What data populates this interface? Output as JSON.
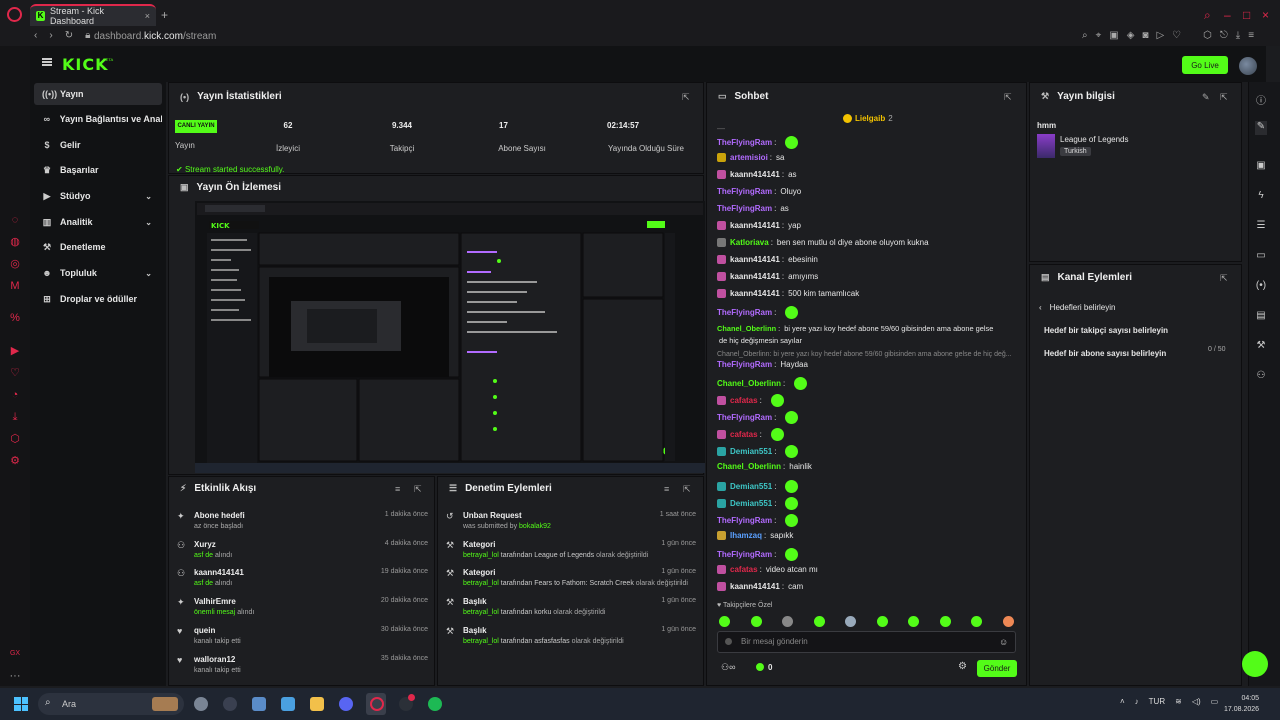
{
  "browser": {
    "tab_title": "Stream - Kick Dashboard",
    "url_prefix": "dashboard.",
    "url_domain": "kick.com",
    "url_path": "/stream"
  },
  "kick": {
    "logo": "KICK",
    "beta": "BETA",
    "go_live": "Go Live"
  },
  "sidebar": {
    "items": [
      {
        "label": "Yayın",
        "icon": "broadcast-icon"
      },
      {
        "label": "Yayın Bağlantısı ve Anahtarı",
        "icon": "link-icon"
      },
      {
        "label": "Gelir",
        "icon": "dollar-icon"
      },
      {
        "label": "Başarılar",
        "icon": "trophy-icon"
      },
      {
        "label": "Stüdyo",
        "icon": "video-icon"
      },
      {
        "label": "Analitik",
        "icon": "chart-icon"
      },
      {
        "label": "Denetleme",
        "icon": "gavel-icon"
      },
      {
        "label": "Topluluk",
        "icon": "people-icon"
      },
      {
        "label": "Droplar ve ödüller",
        "icon": "gift-icon"
      }
    ]
  },
  "stats": {
    "title": "Yayın İstatistikleri",
    "live_badge": "CANLI YAYIN",
    "stream_label": "Yayın",
    "items": [
      {
        "value": "62",
        "label": "İzleyici"
      },
      {
        "value": "9.344",
        "label": "Takipçi"
      },
      {
        "value": "17",
        "label": "Abone Sayısı"
      },
      {
        "value": "02:14:57",
        "label": "Yayında Olduğu Süre"
      }
    ],
    "status": "Stream started successfully."
  },
  "preview": {
    "title": "Yayın Ön İzlemesi"
  },
  "activity": {
    "title": "Etkinlik Akışı",
    "items": [
      {
        "title": "Abone hedefi",
        "sub": "az önce başladı",
        "hl": "",
        "time": "1 dakika önce"
      },
      {
        "title": "Xuryz",
        "sub": " alındı",
        "hl": "asf de",
        "time": "4 dakika önce"
      },
      {
        "title": "kaann414141",
        "sub": " alındı",
        "hl": "asf de",
        "time": "19 dakika önce"
      },
      {
        "title": "VaIhirEmre",
        "sub": " alındı",
        "hl": "önemli mesaj",
        "time": "20 dakika önce"
      },
      {
        "title": "quein",
        "sub": "kanalı takip etti",
        "hl": "",
        "time": "30 dakika önce"
      },
      {
        "title": "walloran12",
        "sub": "kanalı takip etti",
        "hl": "",
        "time": "35 dakika önce"
      }
    ]
  },
  "moderation": {
    "title": "Denetim Eylemleri",
    "items": [
      {
        "title": "Unban Request",
        "pre": "was submitted by ",
        "hl": "bokalak92",
        "post": "",
        "time": "1 saat önce"
      },
      {
        "title": "Kategori",
        "pre": "betrayal_lol",
        "hl": " tarafından League of Legends",
        "post": " olarak değiştirildi",
        "time": "1 gün önce"
      },
      {
        "title": "Kategori",
        "pre": "betrayal_lol",
        "hl": " tarafından Fears to Fathom: Scratch Creek",
        "post": " olarak değiştirildi",
        "time": "1 gün önce"
      },
      {
        "title": "Başlık",
        "pre": "betrayal_lol",
        "hl": " tarafından korku",
        "post": " olarak değiştirildi",
        "time": "1 gün önce"
      },
      {
        "title": "Başlık",
        "pre": "betrayal_lol",
        "hl": " tarafından asfasfasfas",
        "post": " olarak değiştirildi",
        "time": "1 gün önce"
      }
    ]
  },
  "chat": {
    "title": "Sohbet",
    "pinned_user": "Lielgaib",
    "pinned_count": "2",
    "messages": [
      {
        "user": "TheFlyingRam",
        "color": "#b26bff",
        "text": "",
        "emote": true
      },
      {
        "user": "artemisioi",
        "color": "#b26bff",
        "text": "sa",
        "emote": false
      },
      {
        "user": "kaann414141",
        "color": "#e6e6e6",
        "text": "as",
        "emote": false
      },
      {
        "user": "TheFlyingRam",
        "color": "#b26bff",
        "text": "Oluyo",
        "emote": false
      },
      {
        "user": "TheFlyingRam",
        "color": "#b26bff",
        "text": "as",
        "emote": false
      },
      {
        "user": "kaann414141",
        "color": "#e6e6e6",
        "text": "yap",
        "emote": false
      },
      {
        "user": "Katloriava",
        "color": "#53fc18",
        "text": "ben sen mutlu ol diye abone oluyom kukna",
        "emote": false
      },
      {
        "user": "kaann414141",
        "color": "#e6e6e6",
        "text": "ebesinin",
        "emote": false
      },
      {
        "user": "kaann414141",
        "color": "#e6e6e6",
        "text": "amıyıms",
        "emote": false
      },
      {
        "user": "kaann414141",
        "color": "#e6e6e6",
        "text": "500 kim tamamlıcak",
        "emote": false
      },
      {
        "user": "TheFlyingRam",
        "color": "#b26bff",
        "text": "",
        "emote": true
      },
      {
        "user": "Chanel_Oberlinn",
        "color": "#53fc18",
        "text": "bi yere yazı koy hedef abone 59/60 gibisinden ama abone gelse",
        "emote": false
      },
      {
        "user": "",
        "color": "#e6e6e6",
        "text": "de hiç değişmesin sayılar",
        "emote": false
      },
      {
        "user": "TheFlyingRam",
        "color": "#b26bff",
        "text": "Haydaa",
        "emote": false
      },
      {
        "user": "Chanel_Oberlinn",
        "color": "#53fc18",
        "text": "",
        "emote": true
      },
      {
        "user": "cafatas",
        "color": "#e0284b",
        "text": "",
        "emote": true
      },
      {
        "user": "TheFlyingRam",
        "color": "#b26bff",
        "text": "",
        "emote": true
      },
      {
        "user": "cafatas",
        "color": "#e0284b",
        "text": "",
        "emote": true
      },
      {
        "user": "Demian551",
        "color": "#3ec7c7",
        "text": "",
        "emote": true
      },
      {
        "user": "Chanel_Oberlinn",
        "color": "#53fc18",
        "text": "hainlik",
        "emote": false
      },
      {
        "user": "Demian551",
        "color": "#3ec7c7",
        "text": "",
        "emote": true
      },
      {
        "user": "Demian551",
        "color": "#3ec7c7",
        "text": "",
        "emote": true
      },
      {
        "user": "TheFlyingRam",
        "color": "#b26bff",
        "text": "",
        "emote": true
      },
      {
        "user": "Ihamzaq",
        "color": "#5aa0ff",
        "text": "sapıkk",
        "emote": false
      },
      {
        "user": "TheFlyingRam",
        "color": "#b26bff",
        "text": "",
        "emote": true
      },
      {
        "user": "cafatas",
        "color": "#e0284b",
        "text": "video atcan mı",
        "emote": false
      },
      {
        "user": "kaann414141",
        "color": "#e6e6e6",
        "text": "cam",
        "emote": false
      }
    ],
    "reply_text": "Chanel_Oberlinn: bi yere yazı koy hedef abone 59/60 gibisinden ama abone gelse de hiç değ...",
    "emote_label": "Takipçilere Özel",
    "input_placeholder": "Bir mesaj gönderin",
    "count": "0",
    "send_label": "Gönder"
  },
  "info": {
    "title": "Yayın bilgisi",
    "stream_title": "hmm",
    "category": "League of Legends",
    "language": "Turkish"
  },
  "channel_actions": {
    "title": "Kanal Eylemleri",
    "back_label": "Hedefleri belirleyin",
    "items": [
      {
        "label": "Hedef bir takipçi sayısı belirleyin",
        "value": ""
      },
      {
        "label": "Hedef bir abone sayısı belirleyin",
        "value": "0 / 50"
      }
    ]
  },
  "taskbar": {
    "search_placeholder": "Ara",
    "lang": "TUR",
    "time": "04:05",
    "date": "17.08.2026"
  },
  "colors": {
    "accent": "#53fc18",
    "opera": "#e0284b"
  }
}
